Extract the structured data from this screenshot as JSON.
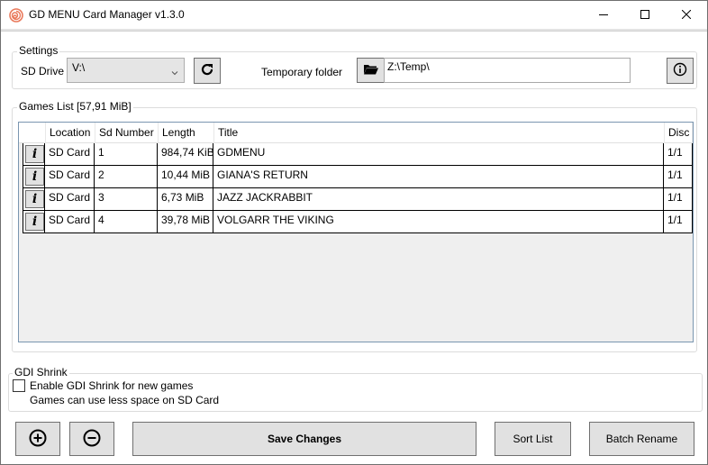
{
  "window": {
    "title": "GD MENU Card Manager v1.3.0",
    "icon": "dreamcast-swirl-icon",
    "controls": [
      "minimize-icon",
      "maximize-icon",
      "close-icon"
    ]
  },
  "settings": {
    "group_label": "Settings",
    "sd_drive_label": "SD Drive",
    "sd_drive_value": "V:\\",
    "refresh_icon": "refresh-icon",
    "temp_folder_label": "Temporary folder",
    "temp_folder_browse_icon": "folder-open-icon",
    "temp_folder_value": "Z:\\Temp\\",
    "about_icon": "info-circle-icon"
  },
  "games_list": {
    "group_label": "Games List [57,91 MiB]",
    "columns": [
      "",
      "Location",
      "Sd Number",
      "Length",
      "Title",
      "Disc"
    ],
    "info_button_glyph": "i",
    "rows": [
      {
        "location": "SD Card",
        "sd_number": "1",
        "length": "984,74 KiB",
        "title": "GDMENU",
        "disc": "1/1"
      },
      {
        "location": "SD Card",
        "sd_number": "2",
        "length": "10,44 MiB",
        "title": "GIANA'S RETURN",
        "disc": "1/1"
      },
      {
        "location": "SD Card",
        "sd_number": "3",
        "length": "6,73 MiB",
        "title": "JAZZ JACKRABBIT",
        "disc": "1/1"
      },
      {
        "location": "SD Card",
        "sd_number": "4",
        "length": "39,78 MiB",
        "title": "VOLGARR THE VIKING",
        "disc": "1/1"
      }
    ]
  },
  "gdi_shrink": {
    "group_label": "GDI Shrink",
    "checkbox_label": "Enable GDI Shrink for new games",
    "checked": false,
    "hint": "Games can use less space on SD Card"
  },
  "actions": {
    "add_icon": "plus-circle-icon",
    "remove_icon": "minus-circle-icon",
    "save_label": "Save Changes",
    "sort_label": "Sort List",
    "batch_rename_label": "Batch Rename"
  }
}
